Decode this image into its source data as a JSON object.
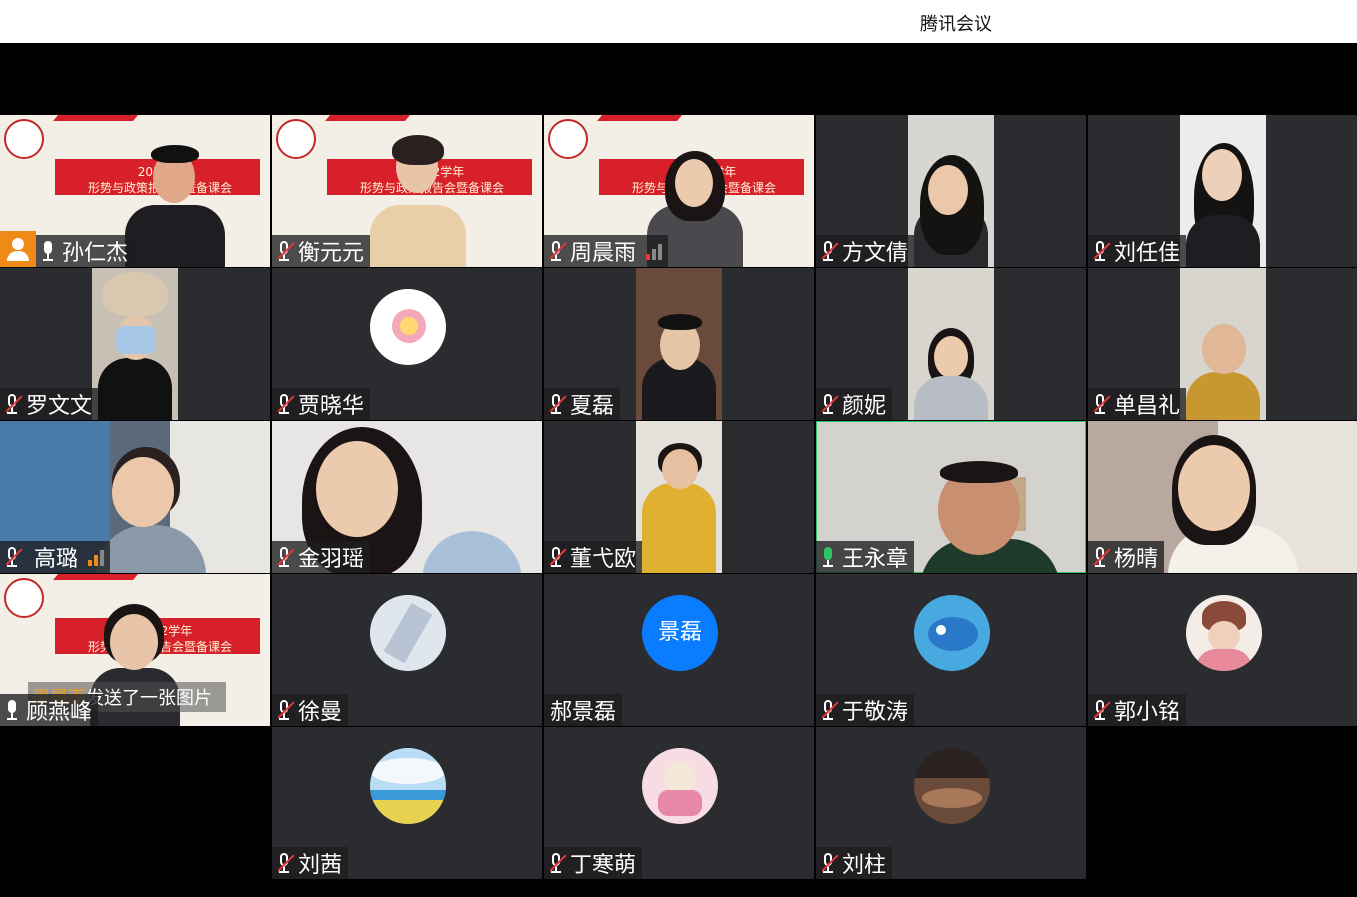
{
  "window": {
    "title": "腾讯会议"
  },
  "slide": {
    "line1": "2022学年",
    "line2": "形势与政策报告会暨备课会"
  },
  "participants": [
    {
      "name": "孙仁杰",
      "mic": "on"
    },
    {
      "name": "衡元元",
      "mic": "muted"
    },
    {
      "name": "周晨雨",
      "mic": "muted"
    },
    {
      "name": "方文倩",
      "mic": "muted"
    },
    {
      "name": "刘任佳",
      "mic": "muted"
    },
    {
      "name": "罗文文",
      "mic": "muted"
    },
    {
      "name": "贾晓华",
      "mic": "muted"
    },
    {
      "name": "夏磊",
      "mic": "muted"
    },
    {
      "name": "颜妮",
      "mic": "muted"
    },
    {
      "name": "单昌礼",
      "mic": "muted"
    },
    {
      "name": "高璐",
      "mic": "muted"
    },
    {
      "name": "金羽瑶",
      "mic": "muted"
    },
    {
      "name": "董弋欧",
      "mic": "muted"
    },
    {
      "name": "王永章",
      "mic": "speaking"
    },
    {
      "name": "杨晴",
      "mic": "muted"
    },
    {
      "name": "顾燕峰",
      "mic": "on"
    },
    {
      "name": "徐曼",
      "mic": "muted"
    },
    {
      "name": "郝景磊",
      "mic": "none",
      "avatar_text": "景磊"
    },
    {
      "name": "于敬涛",
      "mic": "muted"
    },
    {
      "name": "郭小铭",
      "mic": "muted"
    },
    {
      "name": "刘茜",
      "mic": "muted"
    },
    {
      "name": "丁寒萌",
      "mic": "muted"
    },
    {
      "name": "刘柱",
      "mic": "muted"
    }
  ],
  "chat_popup": {
    "sender": "周晨雨",
    "message": "发送了一张图片"
  },
  "colors": {
    "speaking": "#31c267",
    "muted": "#e8363c",
    "accent": "#0a7cff",
    "signal_strong": "#f08a16",
    "signal_weak": "#e8363c"
  },
  "icons": {
    "mic": "mic-icon",
    "muted": "mic-muted-icon",
    "host": "user-icon"
  }
}
